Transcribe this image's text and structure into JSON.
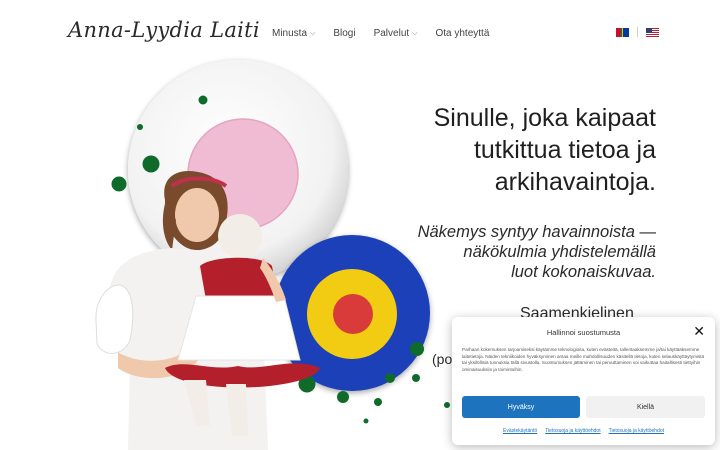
{
  "header": {
    "logo_text": "Anna-Lyydia Laiti",
    "nav": [
      {
        "label": "Minusta",
        "has_dropdown": true
      },
      {
        "label": "Blogi",
        "has_dropdown": false
      },
      {
        "label": "Palvelut",
        "has_dropdown": true
      },
      {
        "label": "Ota yhteyttä",
        "has_dropdown": false
      }
    ],
    "languages": [
      "sami-flag-icon",
      "us-flag-icon"
    ]
  },
  "hero": {
    "headline_lines": [
      "Sinulle, joka kaipaat",
      "tutkittua tietoa ja",
      "arkihavaintoja."
    ],
    "sub_lines": [
      "Näkemys syntyy havainnoista —",
      "näkökulmia yhdistelemällä",
      "luot kokonaiskuvaa."
    ],
    "partial_text": "Saamenkielinen",
    "partial_text_2": "(po"
  },
  "cookie_banner": {
    "title": "Hallinnoi suostumusta",
    "body": "Parhaan kokemuksen tarjoamiseksi käytämme teknologioita, kuten evästeitä, tallentaaksemme ja/tai käyttääksemme laitetietoja. Näiden tekniikoiden hyväksyminen antaa meille mahdollisuuden käsitellä tietoja, kuten selauskäyttäytymistä tai yksilöllisiä tunnuksia tällä sivustolla. Suostumuksen jättäminen tai peruuttaminen voi vaikuttaa haitallisesti tiettyihin ominaisuuksiin ja toimintoihin.",
    "accept_label": "Hyväksy",
    "deny_label": "Kiellä",
    "links": [
      "Evästekäytäntö",
      "Tietosuoja ja käyttöehdot",
      "Tietosuoja ja käyttöehdot"
    ],
    "close_label": "✕"
  },
  "colors": {
    "accent": "#1e73be",
    "circle_pink": "#f0bcd3",
    "circle_blue": "#1a3fb8",
    "circle_yellow": "#f2cc12",
    "circle_red": "#d93b3b",
    "dot_green": "#0f6b2a",
    "dress_red": "#b3202b"
  }
}
